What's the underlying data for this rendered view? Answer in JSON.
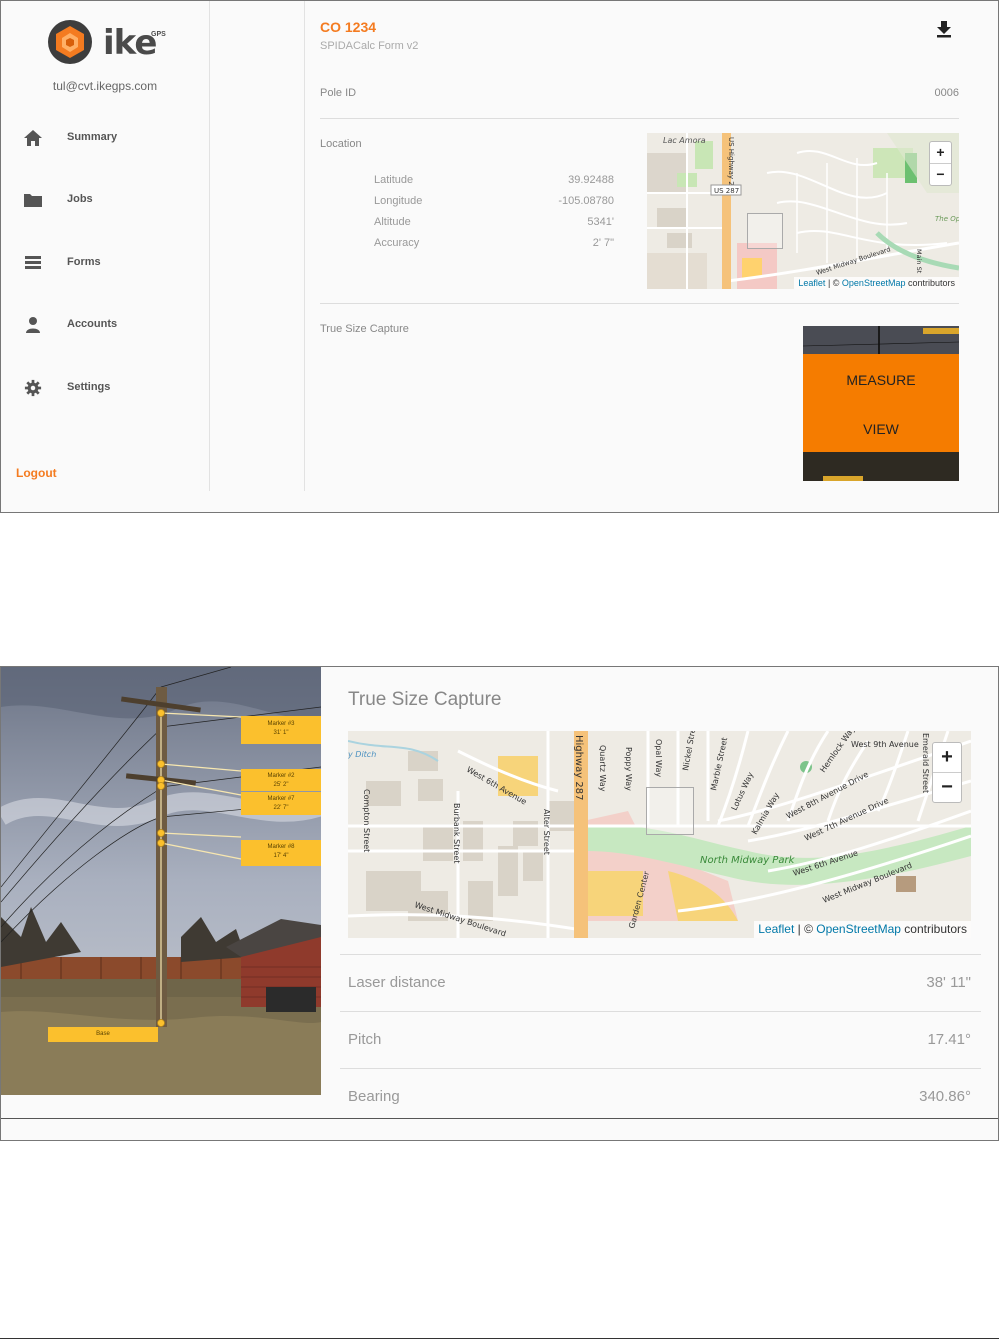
{
  "sidebar": {
    "brand": "ike",
    "brand_sup": "GPS",
    "email": "tul@cvt.ikegps.com",
    "items": [
      {
        "label": "Summary",
        "icon": "home-icon"
      },
      {
        "label": "Jobs",
        "icon": "folder-icon"
      },
      {
        "label": "Forms",
        "icon": "forms-icon"
      },
      {
        "label": "Accounts",
        "icon": "person-icon"
      },
      {
        "label": "Settings",
        "icon": "gear-icon"
      }
    ],
    "logout": "Logout"
  },
  "form": {
    "title": "CO 1234",
    "subtitle": "SPIDACalc Form v2",
    "pole_id_label": "Pole ID",
    "pole_id_value": "0006",
    "location_label": "Location",
    "location": {
      "latitude_label": "Latitude",
      "latitude": "39.92488",
      "longitude_label": "Longitude",
      "longitude": "-105.08780",
      "altitude_label": "Altitude",
      "altitude": "5341'",
      "accuracy_label": "Accuracy",
      "accuracy": "2' 7\""
    },
    "true_size_label": "True Size Capture",
    "measure_label": "MEASURE",
    "view_label": "VIEW"
  },
  "map1": {
    "zoom_in": "+",
    "zoom_out": "−",
    "attribution_leaflet": "Leaflet",
    "attribution_sep": " | © ",
    "attribution_osm": "OpenStreetMap",
    "attribution_tail": " contributors",
    "labels": {
      "lac_amora": "Lac Amora",
      "us_highway": "US Highway 287",
      "us287": "US 287",
      "midway_blvd": "West Midway Boulevard",
      "main_st": "Main St",
      "the_open": "The Open"
    }
  },
  "capture": {
    "title": "True Size Capture",
    "markers": [
      {
        "name": "Marker #3",
        "value": "31' 1\""
      },
      {
        "name": "Marker #2",
        "value": "25' 2\""
      },
      {
        "name": "Marker #7",
        "value": "22' 7\""
      },
      {
        "name": "Marker #8",
        "value": "17' 4\""
      }
    ],
    "base_label": "Base",
    "laser_label": "Laser distance",
    "laser_value": "38' 11\"",
    "pitch_label": "Pitch",
    "pitch_value": "17.41°",
    "bearing_label": "Bearing",
    "bearing_value": "340.86°"
  },
  "map2": {
    "zoom_in": "+",
    "zoom_out": "−",
    "attribution_leaflet": "Leaflet",
    "attribution_sep": " | © ",
    "attribution_osm": "OpenStreetMap",
    "attribution_tail": " contributors",
    "streets": {
      "highway": "Highway 287",
      "w6th": "West 6th Avenue",
      "compton": "Compton Street",
      "burbank": "Burbank Street",
      "alter": "Alter Street",
      "quartz": "Quartz Way",
      "poppy": "Poppy Way",
      "opal": "Opal Way",
      "nickel": "Nickel Street",
      "marble": "Marble Street",
      "lotus": "Lotus Way",
      "kalmia": "Kalmia Way",
      "hemlock": "Hemlock Way",
      "w9th": "West 9th Avenue",
      "emerald": "Emerald Street",
      "w8th": "West 8th Avenue Drive",
      "w7th": "West 7th Avenue Drive",
      "w6th2": "West 6th Avenue",
      "midway": "West Midway Boulevard",
      "midway2": "West Midway Boulevard",
      "garden": "Garden Center",
      "park": "North Midway Park",
      "ditch": "y Ditch"
    }
  },
  "colors": {
    "accent": "#f47b20",
    "measure_orange": "#f57c00",
    "marker_yellow": "#fbc02d",
    "link_blue": "#0078a8"
  }
}
